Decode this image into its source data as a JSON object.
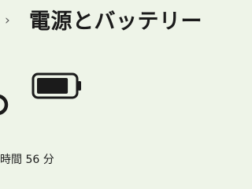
{
  "breadcrumb": {
    "chevron": "›"
  },
  "header": {
    "title": "電源とバッテリー"
  },
  "battery": {
    "icon": "battery-icon",
    "level": 0.85,
    "remaining_label": "時間 56 分"
  },
  "colors": {
    "background": "#eef4e8",
    "text": "#1b1b1b"
  }
}
